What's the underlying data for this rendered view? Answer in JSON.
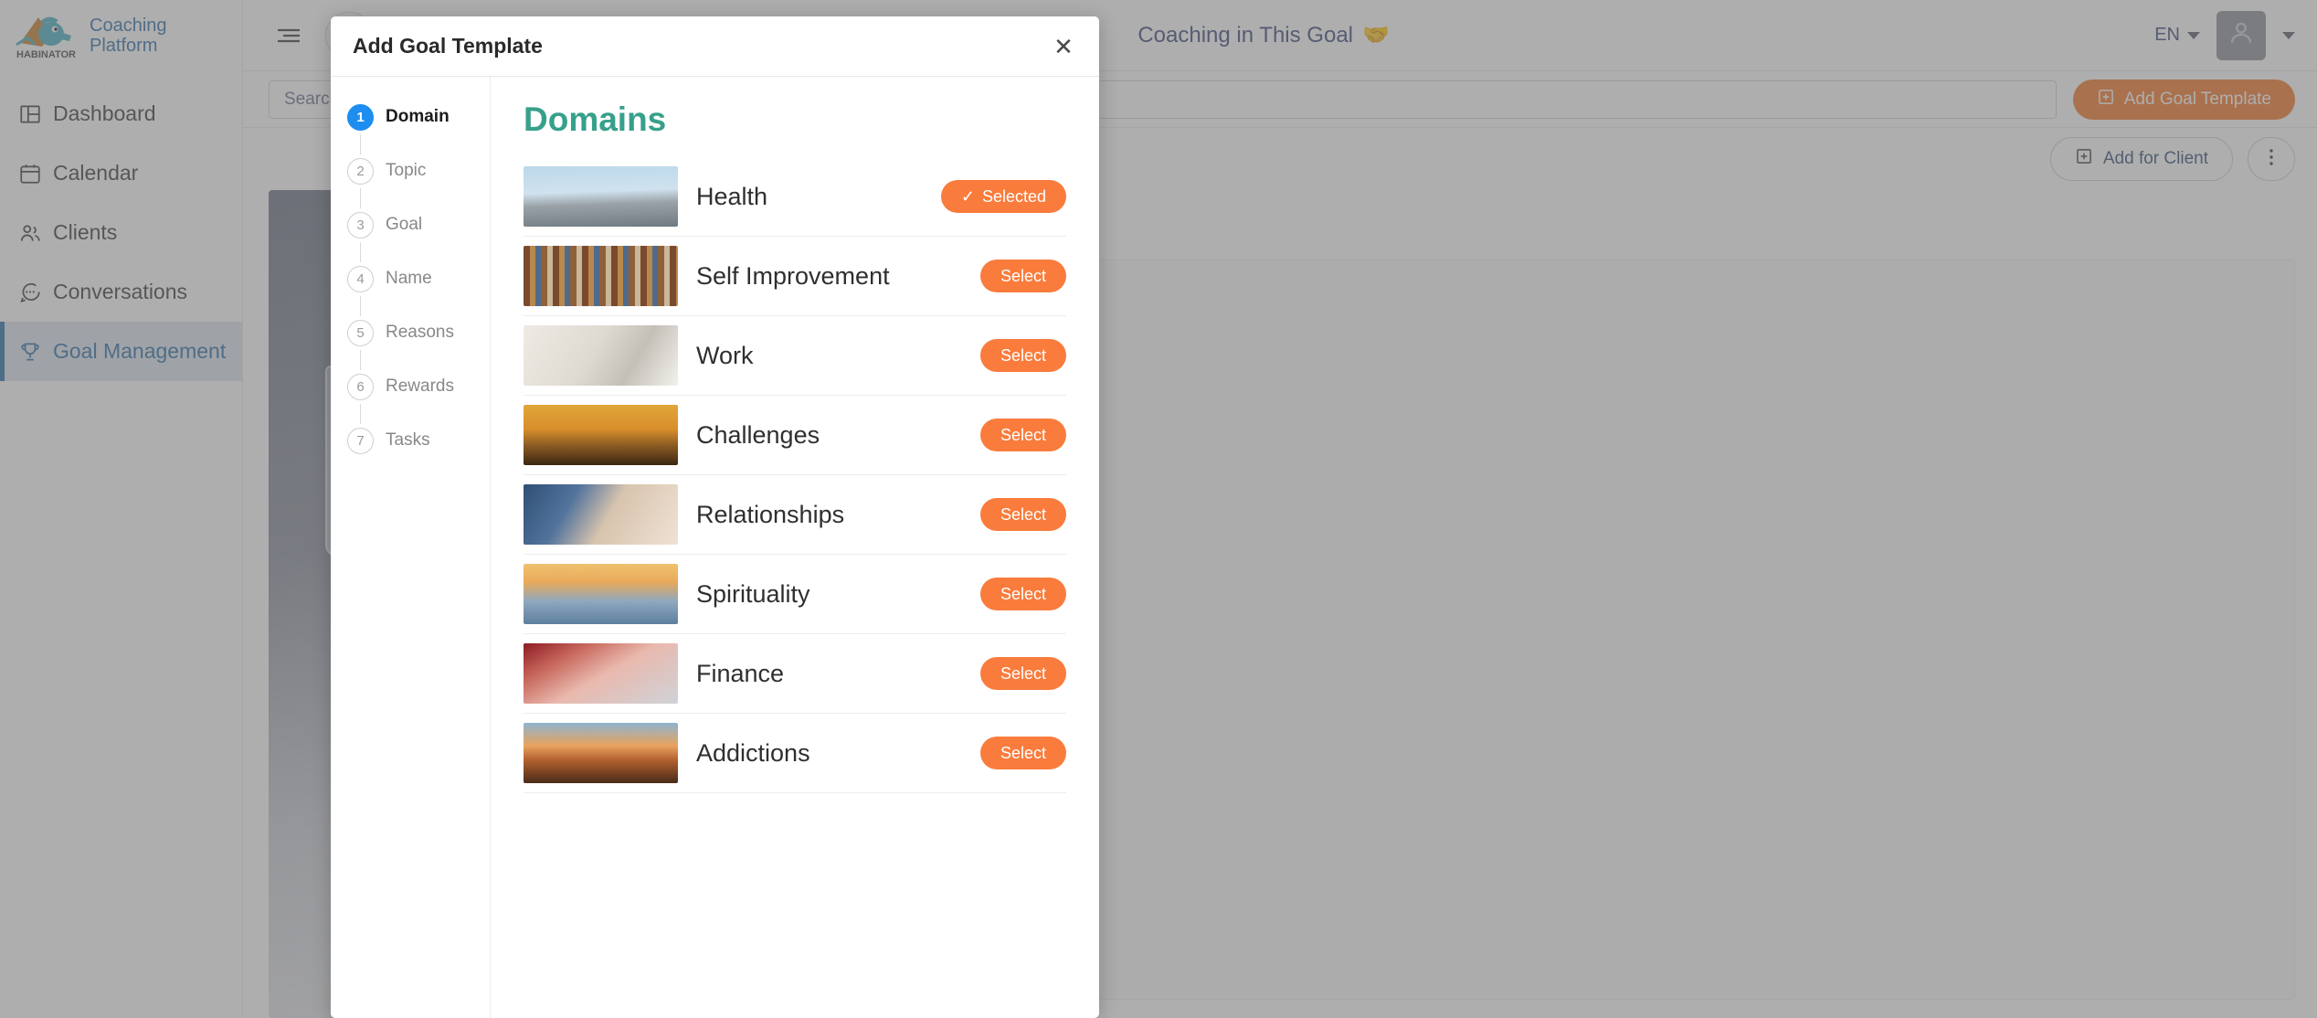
{
  "brand": {
    "name": "Coaching\nPlatform",
    "logo_icon": "habinator-mascot-logo",
    "wordmark": "HABINATOR"
  },
  "sidebar": {
    "items": [
      {
        "label": "Dashboard",
        "icon": "dashboard-icon",
        "active": false
      },
      {
        "label": "Calendar",
        "icon": "calendar-icon",
        "active": false
      },
      {
        "label": "Clients",
        "icon": "users-icon",
        "active": false
      },
      {
        "label": "Conversations",
        "icon": "chat-bubble-icon",
        "active": false
      },
      {
        "label": "Goal Management",
        "icon": "trophy-icon",
        "active": true
      }
    ]
  },
  "topbar": {
    "menu_icon": "hamburger-menu-icon",
    "add_icon": "plus-icon",
    "center_title": "Coaching in This Goal",
    "center_emoji": "🤝",
    "language": "EN",
    "avatar_icon": "user-avatar-icon"
  },
  "toolbar": {
    "search_placeholder": "Search...",
    "search_value": "",
    "add_goal_template_label": "Add Goal Template",
    "add_goal_template_icon": "plus-square-icon"
  },
  "actions": {
    "add_for_client_label": "Add for Client",
    "add_for_client_icon": "plus-square-icon",
    "more_icon": "vertical-dots-icon"
  },
  "modal": {
    "title": "Add Goal Template",
    "close_icon": "close-icon",
    "steps": [
      {
        "number": "1",
        "label": "Domain",
        "active": true
      },
      {
        "number": "2",
        "label": "Topic",
        "active": false
      },
      {
        "number": "3",
        "label": "Goal",
        "active": false
      },
      {
        "number": "4",
        "label": "Name",
        "active": false
      },
      {
        "number": "5",
        "label": "Reasons",
        "active": false
      },
      {
        "number": "6",
        "label": "Rewards",
        "active": false
      },
      {
        "number": "7",
        "label": "Tasks",
        "active": false
      }
    ],
    "panel_title": "Domains",
    "select_label": "Select",
    "selected_label": "Selected",
    "domains": [
      {
        "name": "Health",
        "selected": true,
        "button_label": "Selected"
      },
      {
        "name": "Self Improvement",
        "selected": false,
        "button_label": "Select"
      },
      {
        "name": "Work",
        "selected": false,
        "button_label": "Select"
      },
      {
        "name": "Challenges",
        "selected": false,
        "button_label": "Select"
      },
      {
        "name": "Relationships",
        "selected": false,
        "button_label": "Select"
      },
      {
        "name": "Spirituality",
        "selected": false,
        "button_label": "Select"
      },
      {
        "name": "Finance",
        "selected": false,
        "button_label": "Select"
      },
      {
        "name": "Addictions",
        "selected": false,
        "button_label": "Select"
      }
    ]
  },
  "colors": {
    "accent_orange": "#f97c3c",
    "accent_teal": "#37a08b",
    "accent_blue": "#1d8ef0",
    "brand_blue": "#2f6fa8"
  }
}
